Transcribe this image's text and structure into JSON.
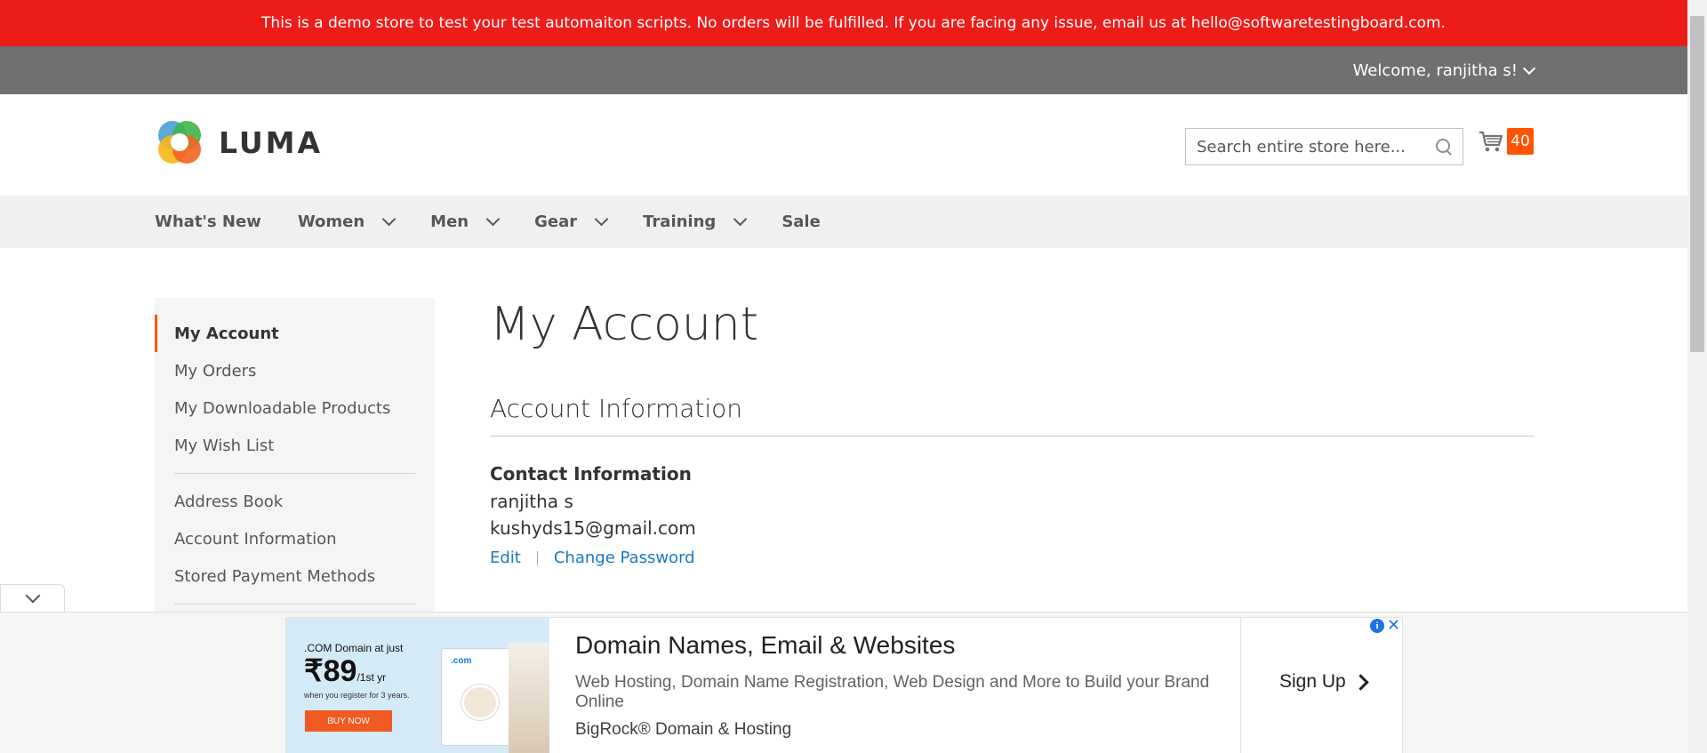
{
  "banner": {
    "text": "This is a demo store to test your test automaiton scripts. No orders will be fulfilled. If you are facing any issue, email us at hello@softwaretestingboard.com."
  },
  "header": {
    "welcome": "Welcome, ranjitha s!",
    "logo_text": "LUMA",
    "logo_colors": [
      "#f26322",
      "#f7b718",
      "#4a9ed9",
      "#3fb549"
    ],
    "search_placeholder": "Search entire store here...",
    "cart_count": "40"
  },
  "nav": {
    "items": [
      {
        "label": "What's New",
        "dropdown": false
      },
      {
        "label": "Women",
        "dropdown": true
      },
      {
        "label": "Men",
        "dropdown": true
      },
      {
        "label": "Gear",
        "dropdown": true
      },
      {
        "label": "Training",
        "dropdown": true
      },
      {
        "label": "Sale",
        "dropdown": false
      }
    ]
  },
  "sidebar": {
    "items": [
      {
        "label": "My Account",
        "active": true
      },
      {
        "label": "My Orders"
      },
      {
        "label": "My Downloadable Products"
      },
      {
        "label": "My Wish List"
      },
      {
        "label": "Address Book"
      },
      {
        "label": "Account Information"
      },
      {
        "label": "Stored Payment Methods"
      }
    ]
  },
  "main": {
    "page_title": "My Account",
    "section_title": "Account Information",
    "contact": {
      "title": "Contact Information",
      "name": "ranjitha s",
      "email": "kushyds15@gmail.com",
      "edit_label": "Edit",
      "change_password_label": "Change Password"
    }
  },
  "ad": {
    "thumb_line1": ".COM Domain at just",
    "thumb_price": "₹89",
    "thumb_price_suffix": "/1st yr",
    "thumb_line3": "when you register for 3 years.",
    "thumb_button": "BUY NOW",
    "thumb_com": ".com",
    "title": "Domain Names, Email & Websites",
    "description": "Web Hosting, Domain Name Registration, Web Design and More to Build your Brand Online",
    "brand": "BigRock® Domain & Hosting",
    "cta": "Sign Up"
  },
  "colors": {
    "accent": "#ff5501",
    "banner_red": "#ee1c19",
    "link": "#1979c3"
  }
}
